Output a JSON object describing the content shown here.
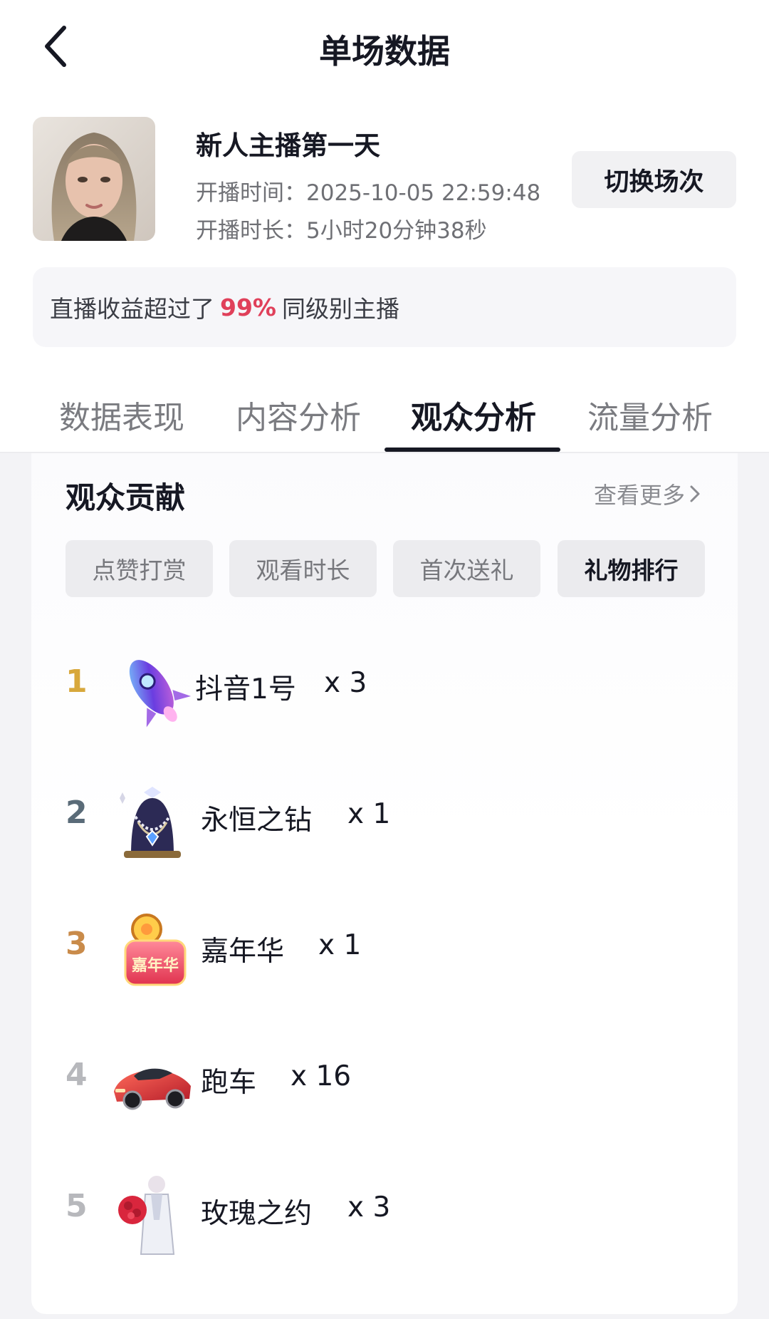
{
  "header": {
    "title": "单场数据",
    "back_icon": "chevron-left-icon"
  },
  "session": {
    "title": "新人主播第一天",
    "start_time": "开播时间：2025-10-05 22:59:48",
    "duration": "开播时长：5小时20分钟38秒",
    "switch_label": "切换场次"
  },
  "banner": {
    "prefix": "直播收益超过了",
    "percent": "99%",
    "suffix": "同级别主播"
  },
  "tabs": [
    {
      "label": "数据表现",
      "active": false
    },
    {
      "label": "内容分析",
      "active": false
    },
    {
      "label": "观众分析",
      "active": true
    },
    {
      "label": "流量分析",
      "active": false
    }
  ],
  "contribution": {
    "title": "观众贡献",
    "see_more": "查看更多",
    "filters": [
      {
        "label": "点赞打赏",
        "active": false
      },
      {
        "label": "观看时长",
        "active": false
      },
      {
        "label": "首次送礼",
        "active": false
      },
      {
        "label": "礼物排行",
        "active": true
      }
    ],
    "gifts": [
      {
        "rank": "1",
        "name": "抖音1号",
        "count": "x 3",
        "rank_color": "#d8a83c",
        "icon": "rocket-gift-icon"
      },
      {
        "rank": "2",
        "name": "永恒之钻",
        "count": "x 1",
        "rank_color": "#5a6b78",
        "icon": "diamond-necklace-gift-icon"
      },
      {
        "rank": "3",
        "name": "嘉年华",
        "count": "x 1",
        "rank_color": "#c98b4a",
        "icon": "carnival-badge-gift-icon"
      },
      {
        "rank": "4",
        "name": "跑车",
        "count": "x 16",
        "rank_color": "#b7b8bc",
        "icon": "sports-car-gift-icon"
      },
      {
        "rank": "5",
        "name": "玫瑰之约",
        "count": "x 3",
        "rank_color": "#b7b8bc",
        "icon": "rose-figure-gift-icon"
      }
    ]
  },
  "colors": {
    "accent_red": "#e0405a",
    "text_primary": "#161823",
    "text_secondary": "#6f7075"
  }
}
